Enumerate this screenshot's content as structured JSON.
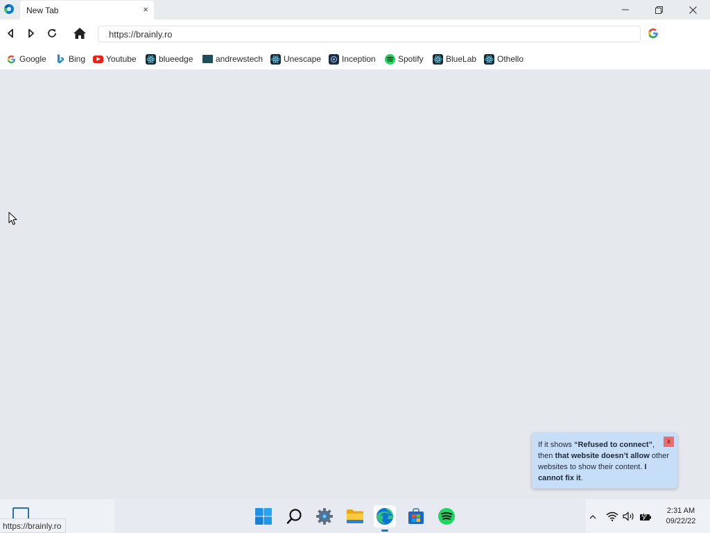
{
  "tab": {
    "title": "New Tab",
    "close": "×"
  },
  "window_controls": {
    "minimize": "minimize",
    "maximize": "restore",
    "close": "close"
  },
  "toolbar": {
    "back": "back-icon",
    "forward": "forward-icon",
    "reload": "reload-icon",
    "home": "home-icon",
    "address_value": "https://brainly.ro",
    "search_engine": "G"
  },
  "bookmarks": [
    {
      "label": "Google",
      "icon": "google-icon"
    },
    {
      "label": "Bing",
      "icon": "bing-icon"
    },
    {
      "label": "Youtube",
      "icon": "youtube-icon"
    },
    {
      "label": "blueedge",
      "icon": "react-icon"
    },
    {
      "label": "andrewstech",
      "icon": "andrewstech-icon"
    },
    {
      "label": "Unescape",
      "icon": "react-icon"
    },
    {
      "label": "Inception",
      "icon": "inception-icon"
    },
    {
      "label": "Spotify",
      "icon": "spotify-icon"
    },
    {
      "label": "BlueLab",
      "icon": "react-icon"
    },
    {
      "label": "Othello",
      "icon": "react-icon"
    }
  ],
  "toast": {
    "part1": "If it shows ",
    "bold1": "“Refused to connect”",
    "part2": ", then ",
    "bold2": "that website doesn’t allow",
    "part3": " other websites to show their content. ",
    "bold3": "I cannot fix it",
    "part4": ".",
    "close": "x"
  },
  "taskbar": {
    "apps": [
      "start",
      "search",
      "settings",
      "file-explorer",
      "edge",
      "store",
      "spotify"
    ],
    "time": "2:31 AM",
    "date": "09/22/22"
  },
  "status_bar": {
    "url": "https://brainly.ro"
  },
  "colors": {
    "accent": "#1a73c8",
    "toast_bg": "#c7def9",
    "toast_close": "#ef6c6c",
    "content_bg": "#e5e8ec"
  }
}
